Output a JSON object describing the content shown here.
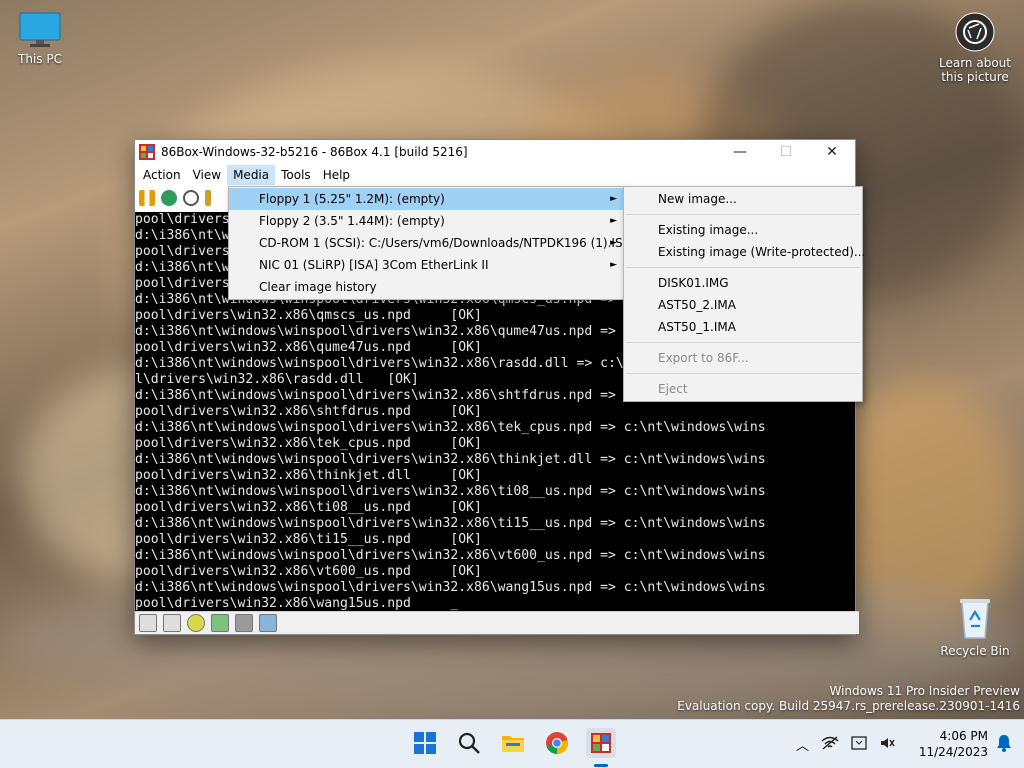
{
  "desktop": {
    "this_pc": "This PC",
    "learn_about_line1": "Learn about",
    "learn_about_line2": "this picture",
    "recycle_bin": "Recycle Bin"
  },
  "window": {
    "title": "86Box-Windows-32-b5216 - 86Box 4.1 [build 5216]",
    "minimize": "—",
    "maximize": "☐",
    "close": "✕"
  },
  "menubar": {
    "action": "Action",
    "view": "View",
    "media": "Media",
    "tools": "Tools",
    "help": "Help"
  },
  "media_menu": {
    "items": [
      "Floppy 1 (5.25\" 1.2M): (empty)",
      "Floppy 2 (3.5\" 1.44M): (empty)",
      "CD-ROM 1 (SCSI): C:/Users/vm6/Downloads/NTPDK196 (1).ISO",
      "NIC 01 (SLiRP) [ISA] 3Com EtherLink II",
      "Clear image history"
    ]
  },
  "floppy_submenu": {
    "new_image": "New image...",
    "existing_image": "Existing image...",
    "existing_image_wp": "Existing image (Write-protected)...",
    "recent": [
      "DISK01.IMG",
      "AST50_2.IMA",
      "AST50_1.IMA"
    ],
    "export": "Export to 86F...",
    "eject": "Eject"
  },
  "console_lines": [
    "pool\\drivers\\win32.x86\\plotter.npd     [OK]",
    "d:\\i386\\nt\\windows\\winspool\\drivers\\win32.x86\\pscript.dll => c:\\nt\\windows\\wins",
    "pool\\drivers\\win32.x86\\pscript.dll     [OK]",
    "d:\\i386\\nt\\windows\\winspool\\drivers\\win32.x86\\qmcpl.dll => c:\\nt\\windows\\wins",
    "pool\\drivers\\win32.x86\\qmcpl.dll       [OK]",
    "d:\\i386\\nt\\windows\\winspool\\drivers\\win32.x86\\qmscs_us.npd => c:\\nt\\windows\\w",
    "pool\\drivers\\win32.x86\\qmscs_us.npd     [OK]",
    "d:\\i386\\nt\\windows\\winspool\\drivers\\win32.x86\\qume47us.npd => c:\\nt\\windows\\w",
    "pool\\drivers\\win32.x86\\qume47us.npd     [OK]",
    "d:\\i386\\nt\\windows\\winspool\\drivers\\win32.x86\\rasdd.dll => c:\\nt\\windows\\winspoo",
    "l\\drivers\\win32.x86\\rasdd.dll   [OK]",
    "d:\\i386\\nt\\windows\\winspool\\drivers\\win32.x86\\shtfdrus.npd => c:\\nt\\windows\\w",
    "pool\\drivers\\win32.x86\\shtfdrus.npd     [OK]",
    "d:\\i386\\nt\\windows\\winspool\\drivers\\win32.x86\\tek_cpus.npd => c:\\nt\\windows\\wins",
    "pool\\drivers\\win32.x86\\tek_cpus.npd     [OK]",
    "d:\\i386\\nt\\windows\\winspool\\drivers\\win32.x86\\thinkjet.dll => c:\\nt\\windows\\wins",
    "pool\\drivers\\win32.x86\\thinkjet.dll     [OK]",
    "d:\\i386\\nt\\windows\\winspool\\drivers\\win32.x86\\ti08__us.npd => c:\\nt\\windows\\wins",
    "pool\\drivers\\win32.x86\\ti08__us.npd     [OK]",
    "d:\\i386\\nt\\windows\\winspool\\drivers\\win32.x86\\ti15__us.npd => c:\\nt\\windows\\wins",
    "pool\\drivers\\win32.x86\\ti15__us.npd     [OK]",
    "d:\\i386\\nt\\windows\\winspool\\drivers\\win32.x86\\vt600_us.npd => c:\\nt\\windows\\wins",
    "pool\\drivers\\win32.x86\\vt600_us.npd     [OK]",
    "d:\\i386\\nt\\windows\\winspool\\drivers\\win32.x86\\wang15us.npd => c:\\nt\\windows\\wins",
    "pool\\drivers\\win32.x86\\wang15us.npd     _"
  ],
  "watermark": {
    "line1": "Windows 11 Pro Insider Preview",
    "line2": "Evaluation copy. Build 25947.rs_prerelease.230901-1416"
  },
  "clock": {
    "time": "4:06 PM",
    "date": "11/24/2023"
  },
  "icons": {
    "taskbar": [
      "start-icon",
      "search-icon",
      "file-explorer-icon",
      "chrome-icon",
      "86box-icon"
    ],
    "tray": [
      "chevron-up-icon",
      "network-icon",
      "language-icon",
      "volume-icon",
      "notification-bell-icon"
    ]
  },
  "colors": {
    "menu_highlight": "#9fd0f5",
    "console_bg": "#000000",
    "console_fg": "#e8e8e8",
    "notification_accent": "#0067c0"
  }
}
